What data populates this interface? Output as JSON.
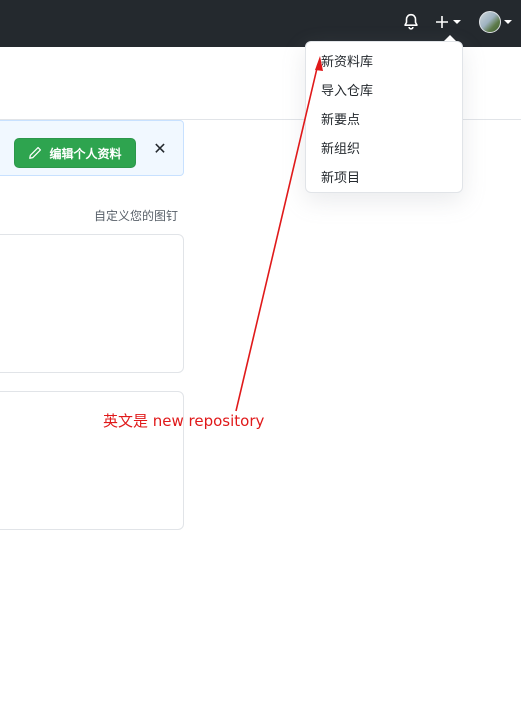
{
  "header": {
    "notifications_icon": "bell-icon",
    "create_icon": "plus-icon",
    "avatar_icon": "avatar"
  },
  "banner": {
    "edit_profile_label": "编辑个人资料",
    "close_symbol": "✕",
    "button_color": "#2ea44f"
  },
  "pinned": {
    "customize_label": "自定义您的图钉"
  },
  "create_menu": {
    "items": [
      {
        "label": "新资料库"
      },
      {
        "label": "导入仓库"
      },
      {
        "label": "新要点"
      },
      {
        "label": "新组织"
      },
      {
        "label": "新项目"
      }
    ]
  },
  "annotation": {
    "text": "英文是 new repository",
    "color": "#e0191a"
  }
}
